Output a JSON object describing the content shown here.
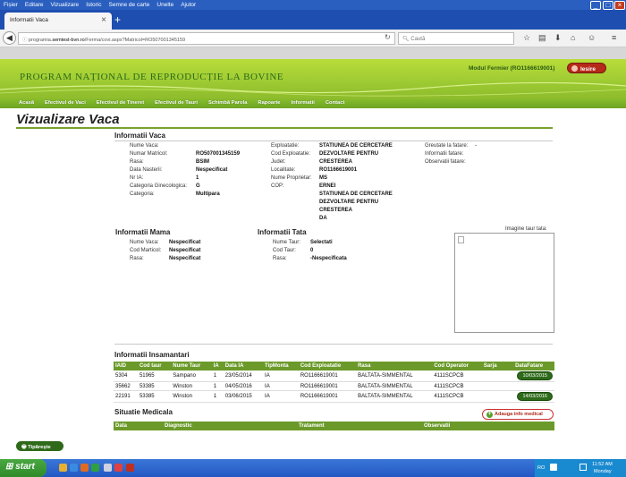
{
  "browser": {
    "menu": [
      "Fișier",
      "Editare",
      "Vizualizare",
      "Istoric",
      "Semne de carte",
      "Unelte",
      "Ajutor"
    ],
    "tab_title": "Informatii Vaca",
    "url_prefix": "programia.",
    "url_domain": "semtest-bvn.ro",
    "url_rest": "/Ferma/covi.aspx?Matricol=RO507001345159",
    "search_placeholder": "Caută"
  },
  "site": {
    "title": "PROGRAM NAȚIONAL DE REPRODUCȚIE LA BOVINE",
    "user": "Modul Fermier (RO1166619001)",
    "logout": "Iesire",
    "nav": [
      "Acasă",
      "Efectivul de Vaci",
      "Efectivul de Tineret",
      "Efectivul de Tauri",
      "Schimbă Parola",
      "Rapoarte",
      "Informatii",
      "Contact"
    ]
  },
  "page_title": "Vizualizare Vaca",
  "vaca": {
    "heading": "Informatii Vaca",
    "col1": [
      {
        "label": "Nume Vaca:",
        "value": ""
      },
      {
        "label": "Numar Matricol:",
        "value": "RO507001345159"
      },
      {
        "label": "Rasa:",
        "value": "BSIM"
      },
      {
        "label": "Data Nasterii:",
        "value": "Nespecificat"
      },
      {
        "label": "Nr IA:",
        "value": "1"
      },
      {
        "label": "Categoria Ginecologica:",
        "value": "G"
      },
      {
        "label": "Categoria:",
        "value": "Multipara"
      }
    ],
    "col2": [
      {
        "label": "Exploatatie:",
        "value": "STATIUNEA DE CERCETARE"
      },
      {
        "label": "Cod Exploatatie:",
        "value": "DEZVOLTARE PENTRU"
      },
      {
        "label": "Judet:",
        "value": "CRESTEREA"
      },
      {
        "label": "Localitate:",
        "value": "RO1166619001"
      },
      {
        "label": "Nume Proprietar:",
        "value": "MS"
      },
      {
        "label": "COP:",
        "value": "ERNEI"
      }
    ],
    "col2_extra": [
      "STATIUNEA DE CERCETARE",
      "DEZVOLTARE PENTRU",
      "CRESTEREA",
      "DA"
    ],
    "col3": [
      {
        "label": "Greutate la fatare:",
        "value": "-"
      },
      {
        "label": "Informatii fatare:",
        "value": ""
      },
      {
        "label": "Observatii fatare:",
        "value": ""
      }
    ]
  },
  "mama": {
    "heading": "Informatii Mama",
    "rows": [
      {
        "label": "Nume Vaca:",
        "value": "Nespecificat"
      },
      {
        "label": "Cod Marticol:",
        "value": "Nespecificat"
      },
      {
        "label": "Rasa:",
        "value": "Nespecificat"
      }
    ]
  },
  "tata": {
    "heading": "Informatii Tata",
    "rows": [
      {
        "label": "Nume Taur:",
        "value": "Selectati"
      },
      {
        "label": "Cod Taur:",
        "value": "0"
      },
      {
        "label": "Rasa:",
        "value": "-Nespecificata"
      }
    ]
  },
  "image_label": "Imagine taur tata:",
  "insamantari": {
    "heading": "Informatii Insamantari",
    "columns": [
      "IAID",
      "Cod taur",
      "Nume Taur",
      "IA",
      "Data IA",
      "TipMonta",
      "Cod Exploatatie",
      "Rasa",
      "Cod Operator",
      "Sarja",
      "DataFatare"
    ],
    "rows": [
      [
        "5304",
        "51965",
        "Sampano",
        "1",
        "23/05/2014",
        "IA",
        "RO1166619001",
        "BALTATA-SIMMENTAL",
        "4111SCPCB",
        "",
        "10/03/2015"
      ],
      [
        "35662",
        "53385",
        "Winston",
        "1",
        "04/05/2016",
        "IA",
        "RO1166619001",
        "BALTATA-SIMMENTAL",
        "4111SCPCB",
        "",
        ""
      ],
      [
        "22191",
        "53385",
        "Winston",
        "1",
        "03/06/2015",
        "IA",
        "RO1166619001",
        "BALTATA-SIMMENTAL",
        "4111SCPCB",
        "",
        "14/03/2016"
      ]
    ]
  },
  "medical": {
    "heading": "Situatie Medicala",
    "add_label": "Adauga info medical",
    "columns": [
      "Data",
      "Diagnostic",
      "Tratament",
      "Observatii"
    ]
  },
  "print_label": "Tipăreşte",
  "taskbar": {
    "start": "start",
    "lang": "RO",
    "time": "11:52 AM",
    "day": "Monday"
  }
}
